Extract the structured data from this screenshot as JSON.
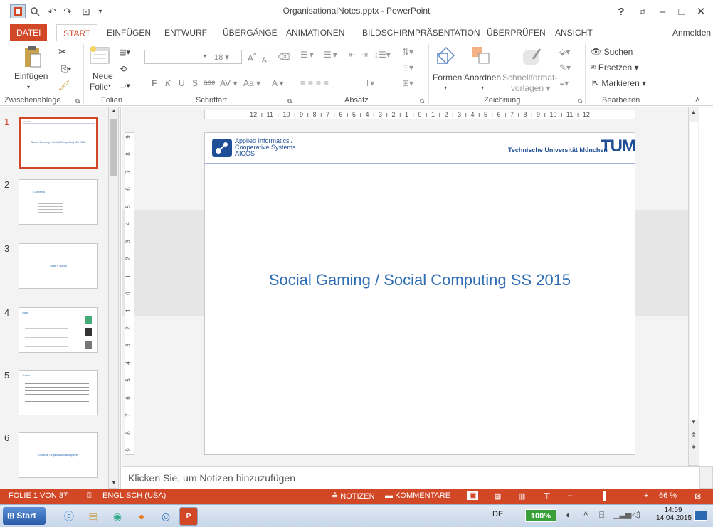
{
  "window": {
    "title": "OrganisationalNotes.pptx - PowerPoint",
    "help": "?",
    "controls": [
      "?",
      "⧉",
      "–",
      "□",
      "✕"
    ]
  },
  "tabs": {
    "file": "DATEI",
    "items": [
      "START",
      "EINFÜGEN",
      "ENTWURF",
      "ÜBERGÄNGE",
      "ANIMATIONEN",
      "BILDSCHIRMPRÄSENTATION",
      "ÜBERPRÜFEN",
      "ANSICHT"
    ],
    "signin": "Anmelden"
  },
  "ribbon": {
    "clipboard": {
      "paste": "Einfügen",
      "group": "Zwischenablage"
    },
    "slides": {
      "new_slide_1": "Neue",
      "new_slide_2": "Folie",
      "group": "Folien"
    },
    "font": {
      "size": "18",
      "bold": "F",
      "italic": "K",
      "underline": "U",
      "shadow": "S",
      "strike": "abc",
      "spacing": "AV",
      "case": "Aa",
      "color": "A",
      "grow": "A",
      "shrink": "A",
      "group": "Schriftart"
    },
    "paragraph": {
      "group": "Absatz"
    },
    "drawing": {
      "shapes": "Formen",
      "arrange": "Anordnen",
      "quick_styles_1": "Schnellformat-",
      "quick_styles_2": "vorlagen",
      "group": "Zeichnung"
    },
    "editing": {
      "find": "Suchen",
      "replace": "Ersetzen",
      "select": "Markieren",
      "group": "Bearbeiten"
    }
  },
  "thumbnails": [
    {
      "num": "1",
      "text": "Social Gaming / Social Computing SS 2015"
    },
    {
      "num": "2",
      "text": "Contents"
    },
    {
      "num": "3",
      "text": "Staff + Tutors"
    },
    {
      "num": "4",
      "text": "Staff"
    },
    {
      "num": "5",
      "text": "Tutors"
    },
    {
      "num": "6",
      "text": "General Organisational Aspects"
    }
  ],
  "ruler": {
    "horizontal": "·12· ı ·11· ı ·10· ı ·9· ı ·8· ı ·7· ı ·6· ı ·5· ı ·4· ı ·3· ı ·2· ı ·1· ı ·0· ı ·1· ı ·2· ı ·3· ı ·4· ı ·5· ı ·6· ı ·7· ı ·8· ı ·9· ı ·10· ı ·11· ı ·12·",
    "vertical": [
      "9",
      "8",
      "7",
      "6",
      "5",
      "4",
      "3",
      "2",
      "1",
      "0",
      "1",
      "2",
      "3",
      "4",
      "5",
      "6",
      "7",
      "8",
      "9"
    ]
  },
  "slide": {
    "logo_line1": "Applied Informatics /",
    "logo_line2": "Cooperative Systems",
    "logo_line3": "AICOS",
    "university": "Technische Universität München",
    "tum": "TUM",
    "title": "Social Gaming / Social Computing  SS 2015"
  },
  "notes": {
    "placeholder": "Klicken Sie, um Notizen hinzuzufügen"
  },
  "status": {
    "slide": "FOLIE 1 VON 37",
    "language": "ENGLISCH (USA)",
    "notes": "NOTIZEN",
    "comments": "KOMMENTARE",
    "zoom": "66 %"
  },
  "taskbar": {
    "start": "Start",
    "lang": "DE",
    "battery": "100%",
    "time": "14:59",
    "date": "14.04.2015"
  },
  "colors": {
    "accent": "#d24726",
    "title_blue": "#2e6db4"
  }
}
